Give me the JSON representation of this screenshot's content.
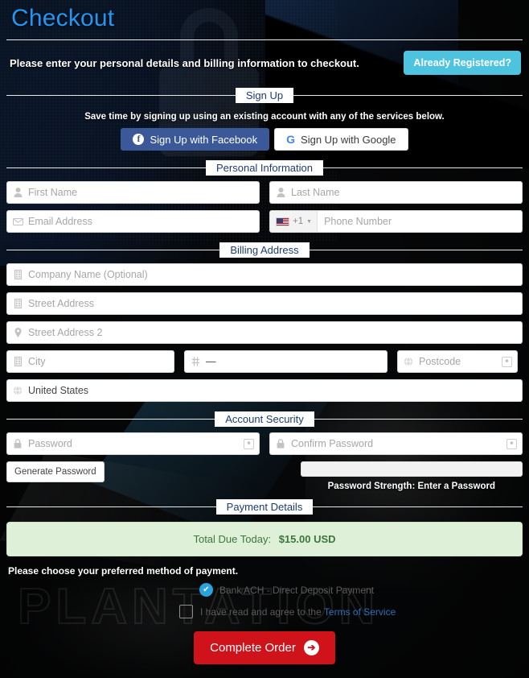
{
  "header": {
    "title": "Checkout",
    "intro": "Please enter your personal details and billing information to checkout.",
    "already_registered_label": "Already Registered?"
  },
  "signup": {
    "section_label": "Sign Up",
    "note": "Save time by signing up using an existing account with any of the services below.",
    "facebook_label": "Sign Up with Facebook",
    "facebook_icon": "facebook-icon",
    "google_label": "Sign Up with Google",
    "google_icon": "google-icon"
  },
  "personal_information": {
    "section_label": "Personal Information",
    "fields": {
      "first_name": {
        "placeholder": "First Name",
        "icon": "user-icon",
        "value": ""
      },
      "last_name": {
        "placeholder": "Last Name",
        "icon": "user-icon",
        "value": ""
      },
      "email": {
        "placeholder": "Email Address",
        "icon": "envelope-icon",
        "value": ""
      },
      "phone": {
        "placeholder": "Phone Number",
        "icon": "flag-icon",
        "dial_code": "+1",
        "country_flag": "us-flag",
        "value": ""
      }
    }
  },
  "billing_address": {
    "section_label": "Billing Address",
    "fields": {
      "company": {
        "placeholder": "Company Name (Optional)",
        "icon": "building-icon",
        "value": ""
      },
      "street1": {
        "placeholder": "Street Address",
        "icon": "building-icon",
        "value": ""
      },
      "street2": {
        "placeholder": "Street Address 2",
        "icon": "map-pin-icon",
        "value": ""
      },
      "city": {
        "placeholder": "City",
        "icon": "building-icon",
        "value": ""
      },
      "state": {
        "placeholder": "",
        "icon": "sliders-icon",
        "value": "—"
      },
      "postcode": {
        "placeholder": "Postcode",
        "icon": "globe-icon",
        "value": "",
        "trailing_icon": "autofill-key-icon"
      },
      "country": {
        "placeholder": "",
        "icon": "globe-icon",
        "value": "United States"
      }
    }
  },
  "account_security": {
    "section_label": "Account Security",
    "fields": {
      "password": {
        "placeholder": "Password",
        "icon": "lock-icon",
        "value": "",
        "trailing_icon": "autofill-key-icon"
      },
      "confirm_password": {
        "placeholder": "Confirm Password",
        "icon": "lock-icon",
        "value": "",
        "trailing_icon": "autofill-key-icon"
      }
    },
    "generate_password_label": "Generate Password",
    "password_strength_text": "Password Strength: Enter a Password"
  },
  "payment_details": {
    "section_label": "Payment Details",
    "total_label": "Total Due Today:",
    "total_amount": "$15.00 USD",
    "choose_note": "Please choose your preferred method of payment.",
    "methods": [
      {
        "label": "Bank ACH - Direct Deposit Payment",
        "selected": true,
        "icon": "radio-checked-icon"
      }
    ],
    "terms_text": "I have read and agree to the",
    "terms_link": "Terms of Service",
    "complete_order_label": "Complete Order",
    "complete_order_icon": "arrow-right-circle-icon"
  },
  "background": {
    "watermark_text": "PLANTATION"
  },
  "colors": {
    "page_title": "#2196f3",
    "already_registered_button": "#4ec3e0",
    "facebook": "#3b5998",
    "google": "#4285f4",
    "section_label_text": "#1d3c6e",
    "total_banner_bg": "#dff0d8",
    "total_banner_text": "#3c763d",
    "radio_selected": "#29a3e0",
    "complete_order_button": "#d0121b",
    "terms_link": "#2f6fb5"
  }
}
